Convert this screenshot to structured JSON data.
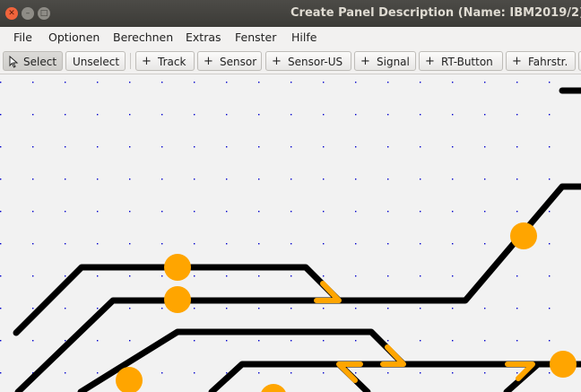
{
  "window": {
    "title": "Create Panel Description (Name: IBM2019/2)",
    "controls": {
      "close_icon": "close-icon",
      "minimize_icon": "minimize-icon",
      "maximize_icon": "maximize-icon"
    }
  },
  "menubar": {
    "items": [
      "File",
      "Optionen",
      "Berechnen",
      "Extras",
      "Fenster",
      "Hilfe"
    ]
  },
  "toolbar": {
    "select_label": "Select",
    "unselect_label": "Unselect",
    "add_track_label": "Track",
    "add_sensor_label": "Sensor",
    "add_sensor_us_label": "Sensor-US",
    "add_signal_label": "Signal",
    "add_rt_button_label": "RT-Button",
    "add_fahrstr_label": "Fahrstr.",
    "plus_glyph": "+"
  },
  "colors": {
    "track": "#000000",
    "sensor": "#ffa500",
    "grid_dot": "#0000cc",
    "canvas_bg": "#f2f2f2"
  }
}
